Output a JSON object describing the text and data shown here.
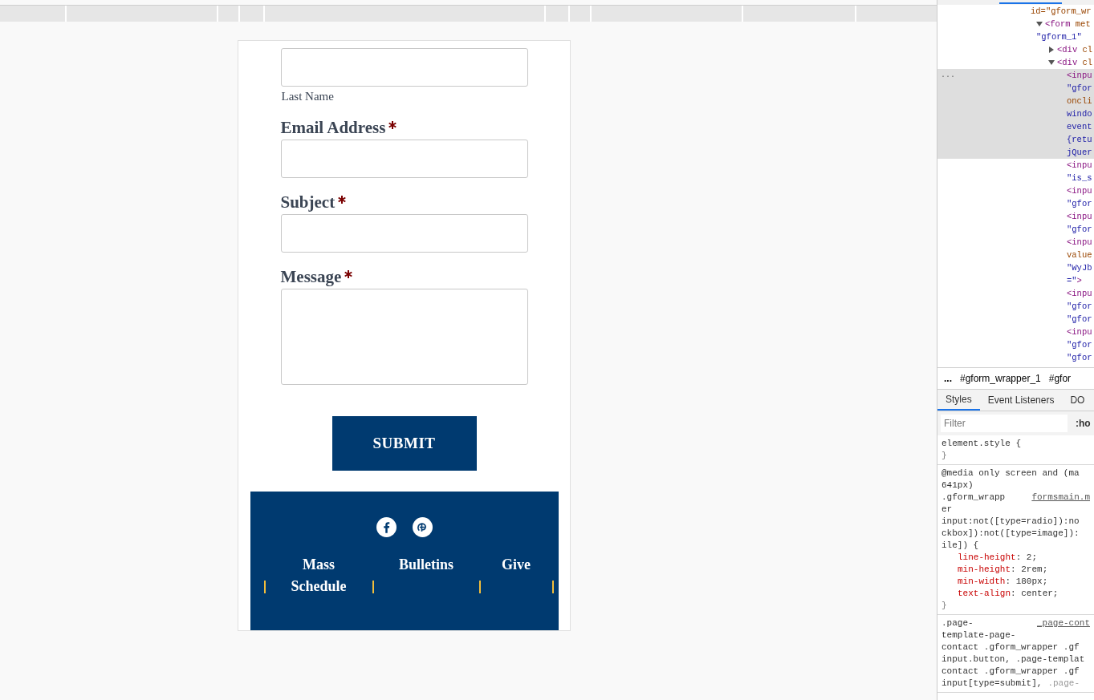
{
  "form": {
    "fields": [
      {
        "kind": "input",
        "sublabel": "Last Name"
      },
      {
        "kind": "input",
        "label": "Email Address",
        "required": true
      },
      {
        "kind": "input",
        "label": "Subject",
        "required": true
      },
      {
        "kind": "textarea",
        "label": "Message",
        "required": true
      }
    ],
    "submit": "SUBMIT"
  },
  "footer": {
    "nav": [
      "Mass Schedule",
      "Bulletins",
      "Give"
    ]
  },
  "devtools": {
    "dom_tree": [
      {
        "lines": [
          [
            {
              "kind": "attr",
              "text": "id=\"gform_wr"
            }
          ]
        ],
        "children": [
          {
            "expanded": true,
            "lines": [
              [
                {
                  "kind": "tag",
                  "text": "<form "
                },
                {
                  "kind": "attr",
                  "text": "met"
                }
              ],
              [
                {
                  "kind": "value",
                  "text": "\"gform_1\""
                }
              ]
            ],
            "children": [
              {
                "expanded": false,
                "lines": [
                  [
                    {
                      "kind": "tag",
                      "text": "<div "
                    },
                    {
                      "kind": "attr",
                      "text": "cl"
                    }
                  ]
                ]
              },
              {
                "expanded": true,
                "lines": [
                  [
                    {
                      "kind": "tag",
                      "text": "<div "
                    },
                    {
                      "kind": "attr",
                      "text": "cl"
                    }
                  ]
                ],
                "children": [
                  {
                    "selected": true,
                    "menu": "...",
                    "lines": [
                      [
                        {
                          "kind": "tag",
                          "text": "<inpu"
                        }
                      ],
                      [
                        {
                          "kind": "value",
                          "text": "\"gfor"
                        }
                      ],
                      [
                        {
                          "kind": "attr",
                          "text": "oncli"
                        }
                      ],
                      [
                        {
                          "kind": "value",
                          "text": "windo"
                        }
                      ],
                      [
                        {
                          "kind": "value",
                          "text": "event"
                        }
                      ],
                      [
                        {
                          "kind": "value",
                          "text": "{retu"
                        }
                      ],
                      [
                        {
                          "kind": "value",
                          "text": "jQuer"
                        }
                      ]
                    ]
                  },
                  {
                    "selected": false,
                    "lines": [
                      [
                        {
                          "kind": "tag",
                          "text": "<inpu"
                        }
                      ],
                      [
                        {
                          "kind": "value",
                          "text": "\"is_s"
                        }
                      ]
                    ]
                  },
                  {
                    "selected": false,
                    "lines": [
                      [
                        {
                          "kind": "tag",
                          "text": "<inpu"
                        }
                      ],
                      [
                        {
                          "kind": "value",
                          "text": "\"gfor"
                        }
                      ]
                    ]
                  },
                  {
                    "selected": false,
                    "lines": [
                      [
                        {
                          "kind": "tag",
                          "text": "<inpu"
                        }
                      ],
                      [
                        {
                          "kind": "value",
                          "text": "\"gfor"
                        }
                      ]
                    ]
                  },
                  {
                    "selected": false,
                    "lines": [
                      [
                        {
                          "kind": "tag",
                          "text": "<inpu"
                        }
                      ],
                      [
                        {
                          "kind": "attr",
                          "text": "value"
                        }
                      ],
                      [
                        {
                          "kind": "value",
                          "text": "\"WyJb"
                        }
                      ],
                      [
                        {
                          "kind": "value",
                          "text": "=\""
                        },
                        {
                          "kind": "tag",
                          "text": ">"
                        }
                      ]
                    ]
                  },
                  {
                    "selected": false,
                    "lines": [
                      [
                        {
                          "kind": "tag",
                          "text": "<inpu"
                        }
                      ],
                      [
                        {
                          "kind": "value",
                          "text": "\"gfor"
                        }
                      ],
                      [
                        {
                          "kind": "value",
                          "text": "\"gfor"
                        }
                      ]
                    ]
                  },
                  {
                    "selected": false,
                    "lines": [
                      [
                        {
                          "kind": "tag",
                          "text": "<inpu"
                        }
                      ],
                      [
                        {
                          "kind": "value",
                          "text": "\"gfor"
                        }
                      ],
                      [
                        {
                          "kind": "value",
                          "text": "\"gfor"
                        }
                      ]
                    ]
                  }
                ]
              }
            ]
          }
        ]
      }
    ],
    "breadcrumbs": [
      "...",
      "#gform_wrapper_1",
      "#gfor"
    ],
    "tabs": [
      {
        "label": "Styles",
        "selected": true
      },
      {
        "label": "Event Listeners",
        "selected": false
      },
      {
        "label": "DO",
        "selected": false
      }
    ],
    "filter": {
      "placeholder": "Filter",
      "pseudo": ":ho"
    },
    "rules": [
      {
        "selector_lines": [
          {
            "text": "element.style {"
          }
        ],
        "closing": "}"
      },
      {
        "selector_lines": [
          {
            "text": "@media only screen and (ma"
          },
          {
            "text": "641px)"
          },
          {
            "text": ".gform_wrapp",
            "source": "formsmain.m"
          },
          {
            "text": "er"
          },
          {
            "text": "input:not([type=radio]):no"
          },
          {
            "text": "ckbox]):not([type=image]):"
          },
          {
            "text": "ile]) {"
          }
        ],
        "declarations": [
          {
            "name": "line-height",
            "separator": ":",
            "value": "2;"
          },
          {
            "name": "min-height",
            "separator": ":",
            "value": "2rem;"
          },
          {
            "name": "min-width",
            "separator": ":",
            "value": "180px;"
          },
          {
            "name": "text-align",
            "separator": ":",
            "value": "center;"
          }
        ],
        "closing": "}"
      },
      {
        "selector_lines": [
          {
            "text": ".page-",
            "source": "_page-cont"
          },
          {
            "text": "template-page-"
          },
          {
            "text": "contact .gform_wrapper .gf"
          },
          {
            "text": "input.button, .page-templat"
          },
          {
            "text": "contact .gform_wrapper .gf"
          },
          {
            "text": "input[type=submit],",
            "faded": ".page-"
          }
        ]
      }
    ]
  }
}
